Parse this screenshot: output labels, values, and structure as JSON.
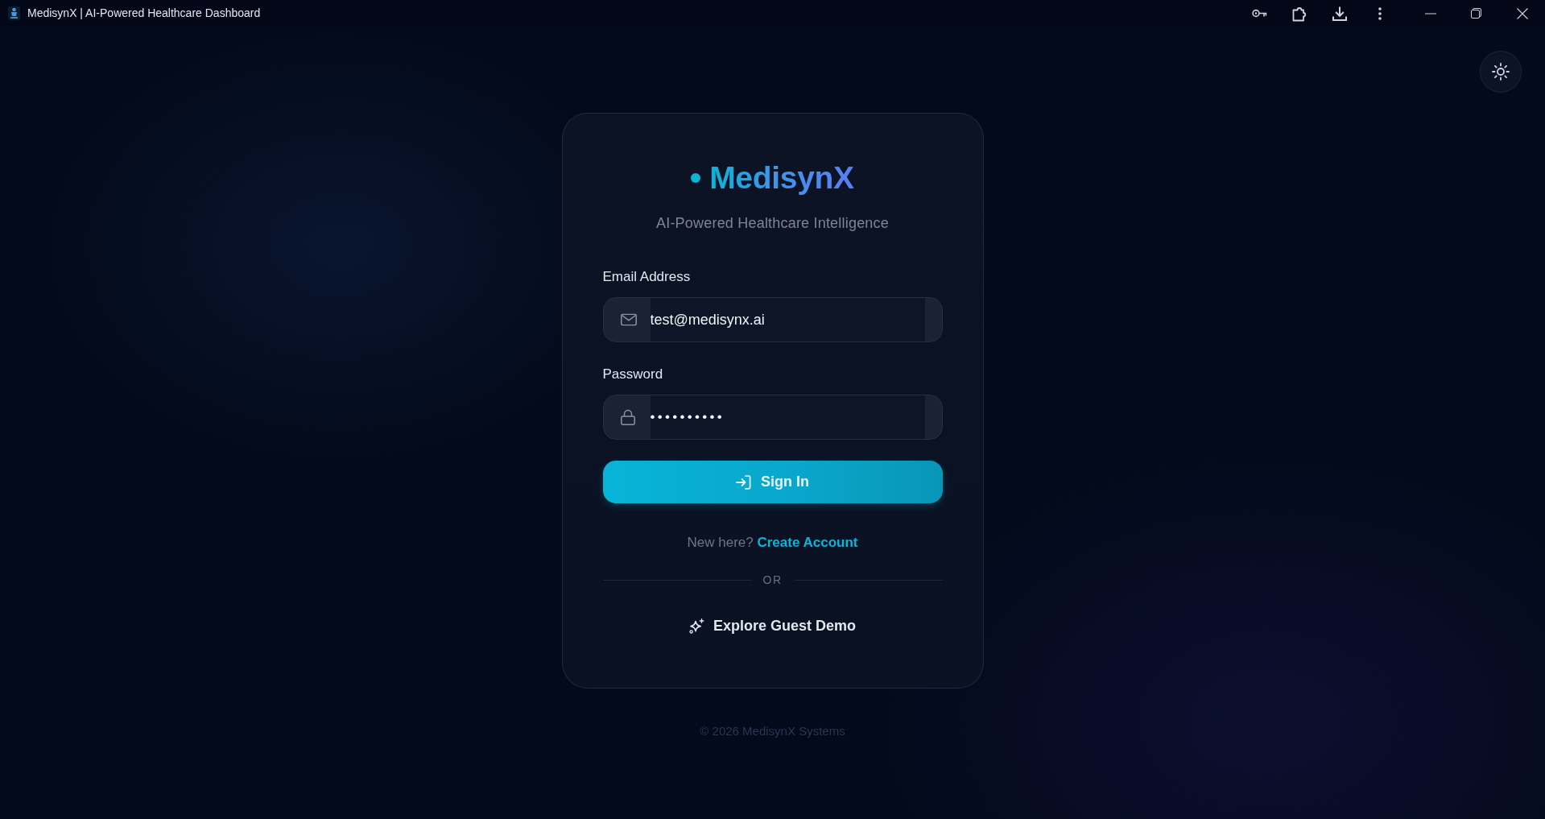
{
  "window": {
    "title": "MedisynX | AI-Powered Healthcare Dashboard"
  },
  "brand": {
    "name": "MedisynX",
    "tagline": "AI-Powered Healthcare Intelligence"
  },
  "form": {
    "fields": [
      {
        "kind": "email",
        "label": "Email Address",
        "value": "test@medisynx.ai"
      },
      {
        "kind": "password",
        "label": "Password",
        "value": "••••••••••"
      }
    ],
    "submit": "Sign In",
    "signup": {
      "prompt": "New here?",
      "link": "Create Account"
    },
    "divider": "OR",
    "guest": "Explore Guest Demo"
  },
  "footer": "© 2026 MedisynX Systems"
}
